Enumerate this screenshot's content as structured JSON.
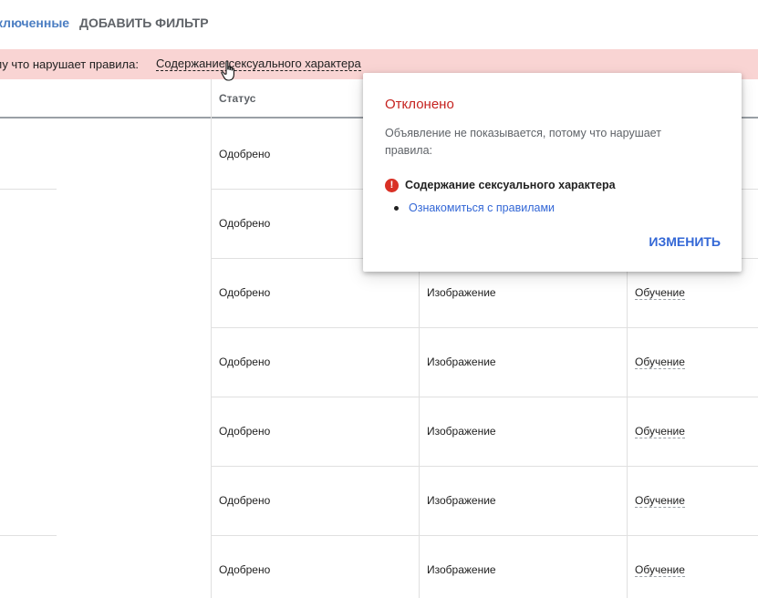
{
  "filters": {
    "active_chip_label": "ключенные",
    "add_filter_label": "ДОБАВИТЬ ФИЛЬТР"
  },
  "banner": {
    "text": "ому что нарушает правила:",
    "policy_link": "Содержание сексуального характера",
    "background_color": "#f9d4d3"
  },
  "table": {
    "status_header": "Статус",
    "rows": [
      {
        "status": "Одобрено",
        "type": "",
        "goal": ""
      },
      {
        "status": "Одобрено",
        "type": "",
        "goal": ""
      },
      {
        "status": "Одобрено",
        "type": "Изображение",
        "goal": "Обучение"
      },
      {
        "status": "Одобрено",
        "type": "Изображение",
        "goal": "Обучение"
      },
      {
        "status": "Одобрено",
        "type": "Изображение",
        "goal": "Обучение"
      },
      {
        "status": "Одобрено",
        "type": "Изображение",
        "goal": "Обучение"
      },
      {
        "status": "Одобрено",
        "type": "Изображение",
        "goal": "Обучение"
      }
    ]
  },
  "popup": {
    "title": "Отклонено",
    "title_color": "#c5221f",
    "description": "Объявление не показывается, потому что нарушает правила:",
    "violation_icon": "error-icon",
    "violation": "Содержание сексуального характера",
    "policy_link": "Ознакомиться с правилами",
    "action_label": "ИЗМЕНИТЬ",
    "accent_color": "#3367d6"
  },
  "cursor_icon": "hand-pointer-icon"
}
